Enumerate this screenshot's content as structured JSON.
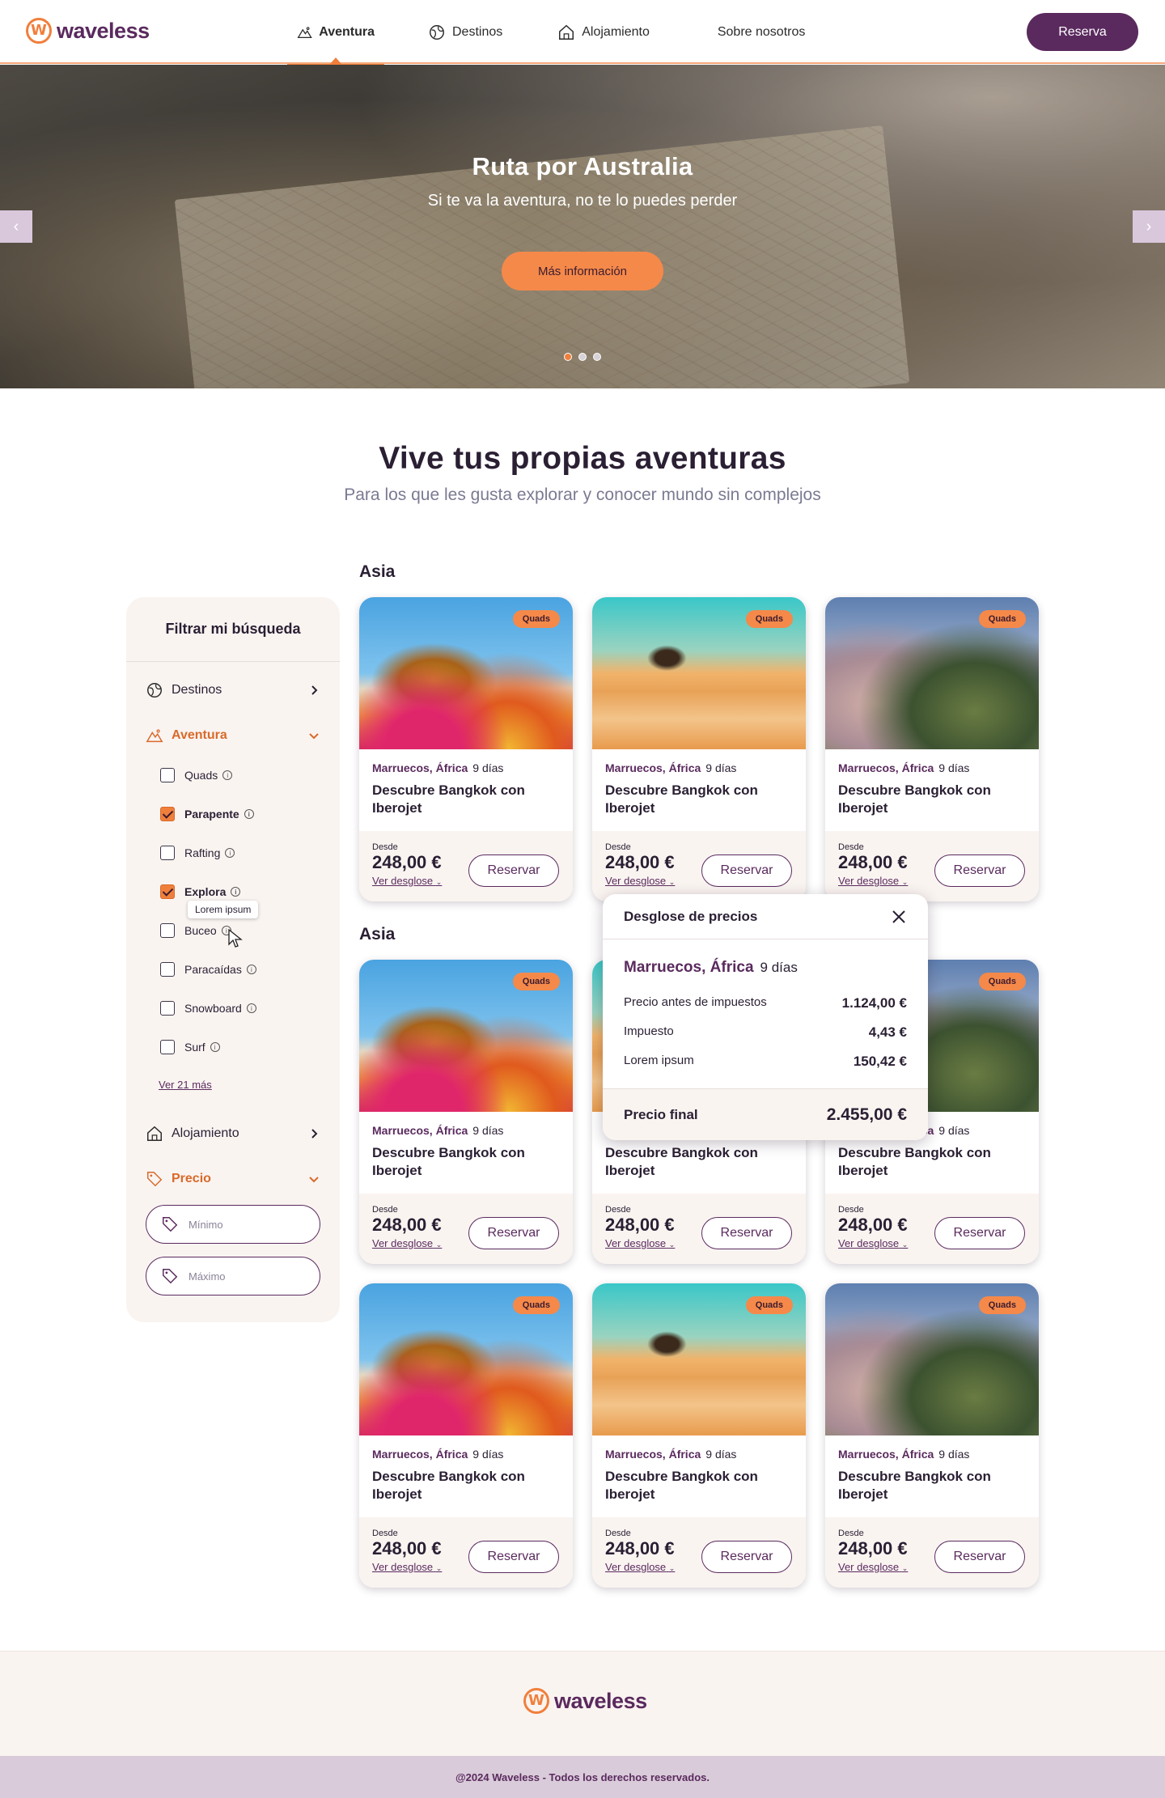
{
  "header": {
    "logo": "waveless",
    "nav": [
      {
        "label": "Aventura",
        "icon": "mountain-icon"
      },
      {
        "label": "Destinos",
        "icon": "globe-icon"
      },
      {
        "label": "Alojamiento",
        "icon": "house-icon"
      },
      {
        "label": "Sobre nosotros",
        "icon": ""
      }
    ],
    "reserva": "Reserva"
  },
  "hero": {
    "title": "Ruta por Australia",
    "subtitle": "Si te va la aventura, no te lo puedes perder",
    "button": "Más información",
    "slides": 3,
    "active_slide": 1
  },
  "section": {
    "title": "Vive tus propias aventuras",
    "subtitle": "Para los que les gusta explorar y conocer mundo sin complejos"
  },
  "filters": {
    "title": "Filtrar mi búsqueda",
    "destinos": "Destinos",
    "aventura": "Aventura",
    "options": [
      {
        "label": "Quads",
        "checked": false
      },
      {
        "label": "Parapente",
        "checked": true
      },
      {
        "label": "Rafting",
        "checked": false
      },
      {
        "label": "Explora",
        "checked": true
      },
      {
        "label": "Buceo",
        "checked": false
      },
      {
        "label": "Paracaídas",
        "checked": false
      },
      {
        "label": "Snowboard",
        "checked": false
      },
      {
        "label": "Surf",
        "checked": false
      }
    ],
    "ver_mas": "Ver 21 más",
    "tooltip": "Lorem ipsum",
    "alojamiento": "Alojamiento",
    "precio": "Precio",
    "min_placeholder": "Mínimo",
    "max_placeholder": "Máximo"
  },
  "groups": [
    "Asia",
    "Asia"
  ],
  "card": {
    "badge": "Quads",
    "location": "Marruecos, África",
    "days": "9 días",
    "title": "Descubre Bangkok con Iberojet",
    "desde": "Desde",
    "price": "248,00 €",
    "ver_desglose": "Ver desglose",
    "reservar": "Reservar"
  },
  "popup": {
    "title": "Desglose de precios",
    "location": "Marruecos, África",
    "days": "9 días",
    "rows": [
      {
        "label": "Precio antes de impuestos",
        "value": "1.124,00 €"
      },
      {
        "label": "Impuesto",
        "value": "4,43 €"
      },
      {
        "label": "Lorem ipsum",
        "value": "150,42 €"
      }
    ],
    "final_label": "Precio final",
    "final_value": "2.455,00 €"
  },
  "footer": {
    "logo": "waveless",
    "copyright": "@2024 Waveless - Todos los derechos reservados."
  },
  "colors": {
    "brand": "#5a2a5e",
    "accent": "#f07f3c",
    "surface": "#faf4f1"
  }
}
